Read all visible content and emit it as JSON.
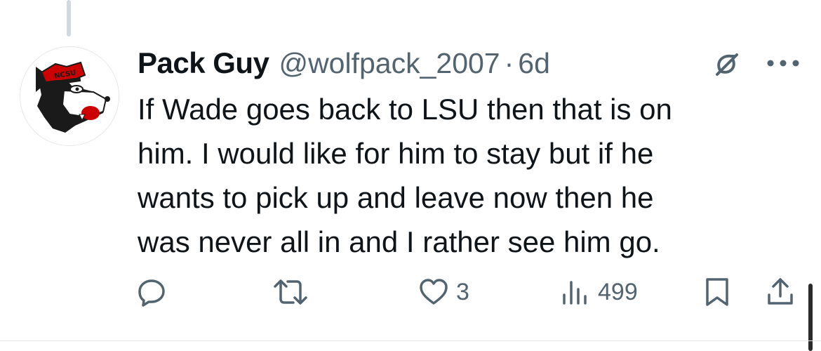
{
  "tweet": {
    "display_name": "Pack Guy",
    "handle": "@wolfpack_2007",
    "separator": "·",
    "time": "6d",
    "text": "If Wade goes back to LSU then that is on\nhim. I would like for him to stay but if he\nwants to pick up and leave now then he\nwas never all in and I rather see him go."
  },
  "avatar": {
    "icon": "ncsu-wolf-logo",
    "logo_text": "NCSU"
  },
  "actions": {
    "reply_icon": "reply-icon",
    "retweet_icon": "retweet-icon",
    "like_icon": "heart-icon",
    "like_count": "3",
    "views_icon": "views-chart-icon",
    "views_count": "499",
    "bookmark_icon": "bookmark-icon",
    "share_icon": "share-icon"
  },
  "colors": {
    "text": "#0f1419",
    "secondary": "#536471",
    "ncsu_red": "#cc0000"
  }
}
